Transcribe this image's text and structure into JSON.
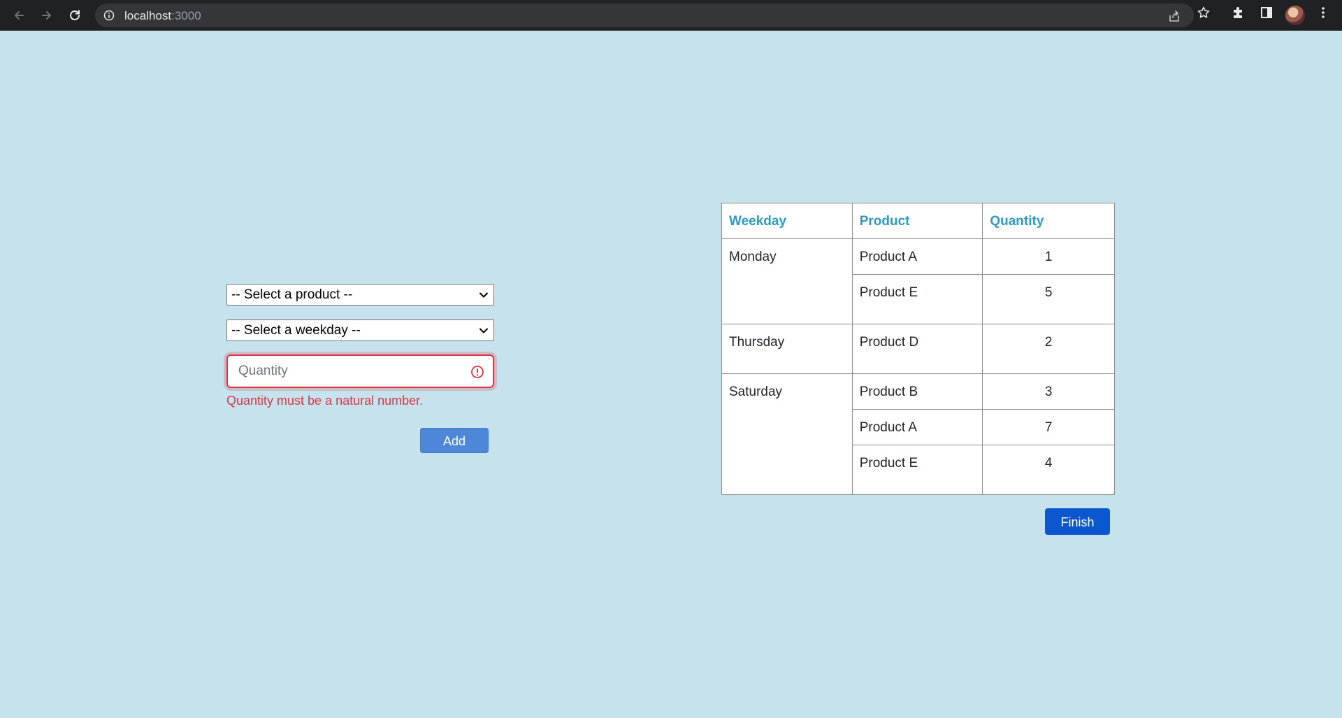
{
  "browser": {
    "url_host": "localhost",
    "url_port": ":3000"
  },
  "form": {
    "product_select": {
      "selected": "-- Select a product --"
    },
    "weekday_select": {
      "selected": "-- Select a weekday --"
    },
    "quantity_input": {
      "placeholder": "Quantity",
      "value": ""
    },
    "error_message": "Quantity must be a natural number.",
    "add_label": "Add"
  },
  "table": {
    "headers": [
      "Weekday",
      "Product",
      "Quantity"
    ],
    "groups": [
      {
        "weekday": "Monday",
        "rows": [
          {
            "product": "Product A",
            "quantity": "1"
          },
          {
            "product": "Product E",
            "quantity": "5"
          }
        ]
      },
      {
        "weekday": "Thursday",
        "rows": [
          {
            "product": "Product D",
            "quantity": "2"
          }
        ]
      },
      {
        "weekday": "Saturday",
        "rows": [
          {
            "product": "Product B",
            "quantity": "3"
          },
          {
            "product": "Product A",
            "quantity": "7"
          },
          {
            "product": "Product E",
            "quantity": "4"
          }
        ]
      }
    ]
  },
  "finish_label": "Finish",
  "colors": {
    "page_background": "#c6e3ed",
    "header_text": "#2d9ac7",
    "error": "#dc3545",
    "add_button": "#4e86d8",
    "finish_button": "#0b57d0"
  }
}
